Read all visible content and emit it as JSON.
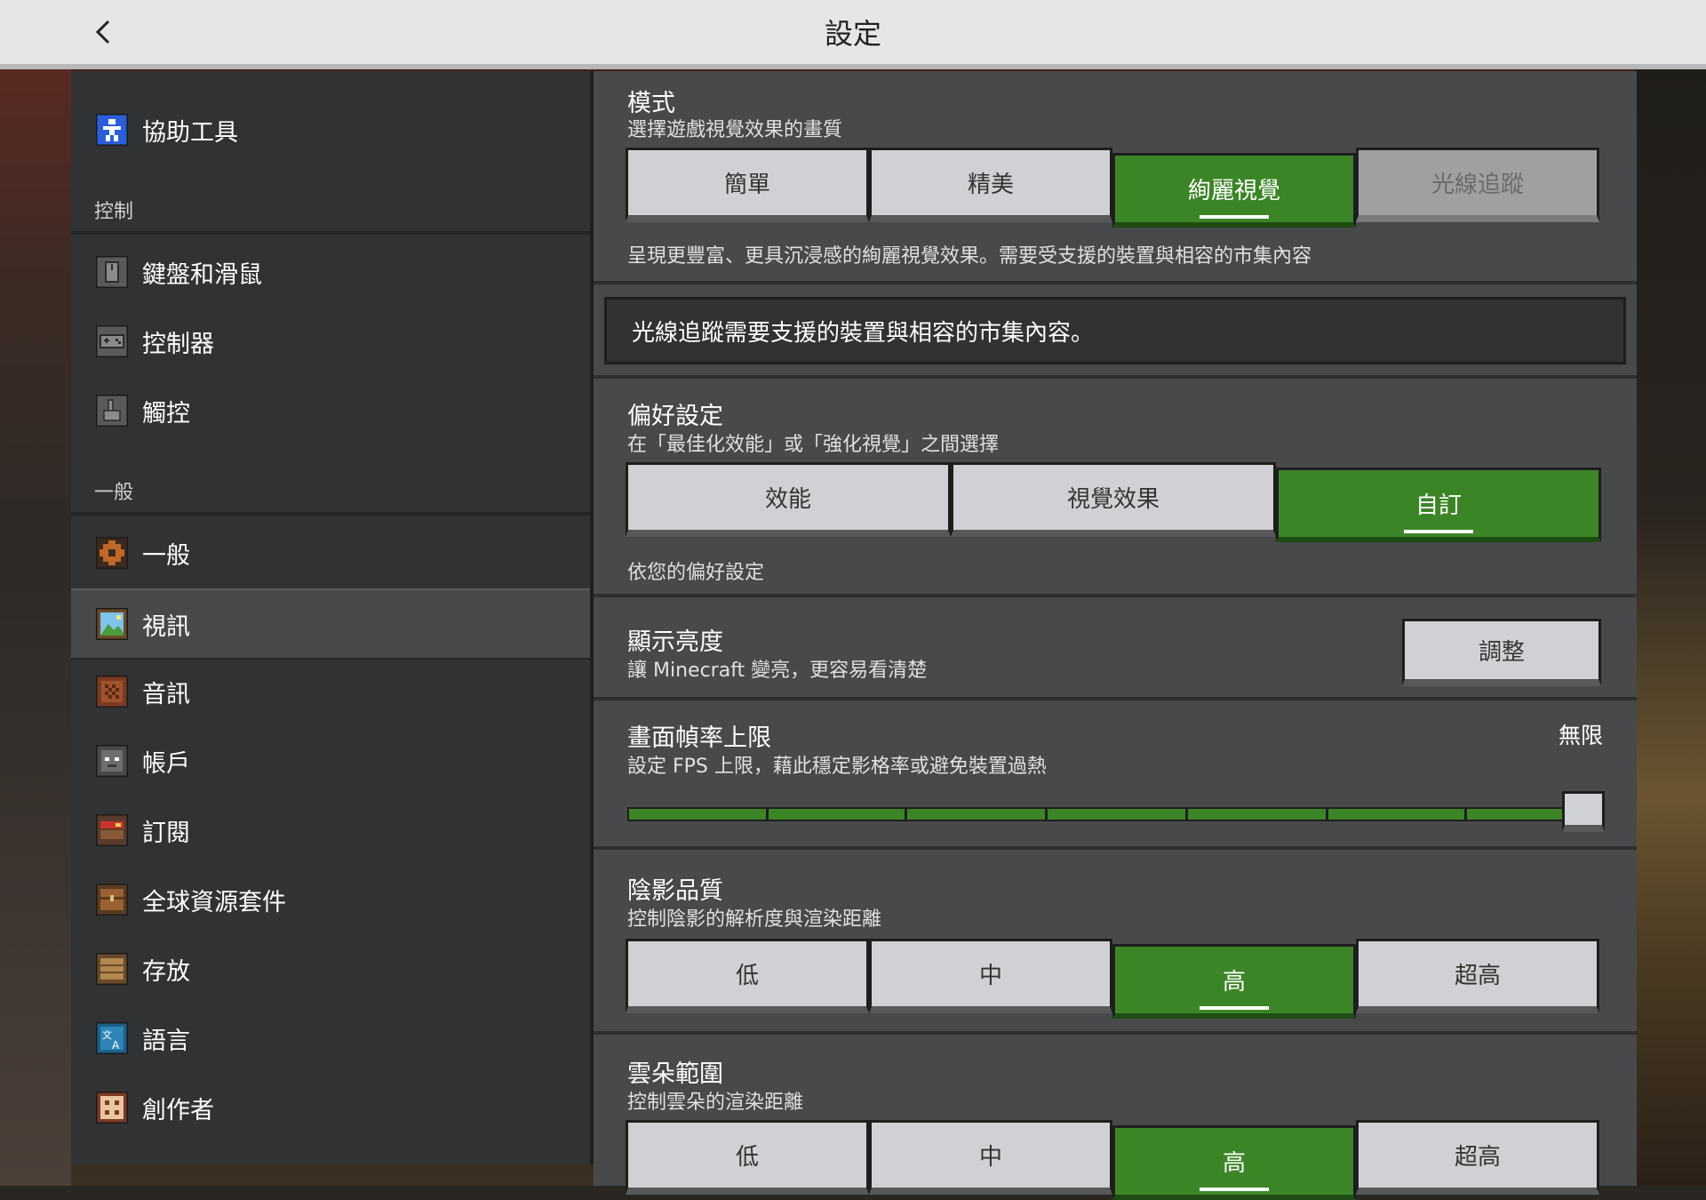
{
  "header": {
    "title": "設定",
    "back_icon": "chevron-left-icon"
  },
  "sidebar": {
    "top_item": {
      "label": "協助工具",
      "icon": "accessibility-icon"
    },
    "section_controls": "控制",
    "controls": [
      {
        "label": "鍵盤和滑鼠",
        "icon": "mouse-icon"
      },
      {
        "label": "控制器",
        "icon": "controller-icon"
      },
      {
        "label": "觸控",
        "icon": "touch-icon"
      }
    ],
    "section_general": "一般",
    "general": [
      {
        "label": "一般",
        "icon": "gear-icon"
      },
      {
        "label": "視訊",
        "icon": "video-icon",
        "selected": true
      },
      {
        "label": "音訊",
        "icon": "audio-icon"
      },
      {
        "label": "帳戶",
        "icon": "account-icon"
      },
      {
        "label": "訂閱",
        "icon": "subscription-icon"
      },
      {
        "label": "全球資源套件",
        "icon": "resource-pack-icon"
      },
      {
        "label": "存放",
        "icon": "storage-icon"
      },
      {
        "label": "語言",
        "icon": "language-icon"
      },
      {
        "label": "創作者",
        "icon": "creator-icon"
      }
    ]
  },
  "mode": {
    "title": "模式",
    "subtitle": "選擇遊戲視覺效果的畫質",
    "options": [
      "簡單",
      "精美",
      "絢麗視覺",
      "光線追蹤"
    ],
    "selected": "絢麗視覺",
    "description": "呈現更豐富、更具沉浸感的絢麗視覺效果。需要受支援的裝置與相容的市集內容"
  },
  "notice": "光線追蹤需要支援的裝置與相容的市集內容。",
  "preference": {
    "title": "偏好設定",
    "subtitle": "在「最佳化效能」或「強化視覺」之間選擇",
    "options": [
      "效能",
      "視覺效果",
      "自訂"
    ],
    "selected": "自訂",
    "description": "依您的偏好設定"
  },
  "brightness": {
    "title": "顯示亮度",
    "subtitle": "讓 Minecraft 變亮，更容易看清楚",
    "button": "調整"
  },
  "fps": {
    "title": "畫面幀率上限",
    "subtitle": "設定 FPS 上限，藉此穩定影格率或避免裝置過熱",
    "value": "無限",
    "slider_fraction": 1.0
  },
  "shadow": {
    "title": "陰影品質",
    "subtitle": "控制陰影的解析度與渲染距離",
    "options": [
      "低",
      "中",
      "高",
      "超高"
    ],
    "selected": "高"
  },
  "clouds": {
    "title": "雲朵範圍",
    "subtitle": "控制雲朵的渲染距離",
    "options": [
      "低",
      "中",
      "高",
      "超高"
    ],
    "selected": "高"
  },
  "colors": {
    "accent_green": "#3c8527",
    "panel": "#48494a",
    "sidebar": "#313233"
  }
}
